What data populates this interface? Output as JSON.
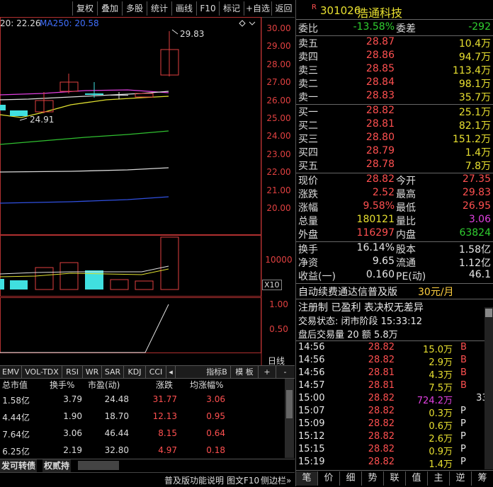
{
  "toolbar": {
    "items": [
      "复权",
      "叠加",
      "多股",
      "统计",
      "画线",
      "F10",
      "标记",
      "+自选",
      "返回"
    ]
  },
  "chart": {
    "ma_text": "20: 22.26",
    "ma250_text": "MA250: 20.58",
    "high_label": "29.83",
    "low_label": "24.91",
    "price_axis": [
      "30.00",
      "29.00",
      "28.00",
      "27.00",
      "26.00",
      "25.00",
      "24.00",
      "23.00",
      "22.00",
      "21.00",
      "20.00"
    ],
    "vol_axis": "10000",
    "vol_unit": "X10",
    "ind_axis": [
      "1.00",
      "0.50"
    ],
    "period": "日线"
  },
  "indicator_tabs": [
    "EMV",
    "VOL-TDX",
    "RSI",
    "WR",
    "SAR",
    "KDJ",
    "CCI"
  ],
  "indicator_right": [
    "指标B",
    "模 板",
    "+",
    "-"
  ],
  "stats": {
    "headers": [
      "总市值",
      "换手%",
      "市盈(动)",
      "涨跌",
      "均涨幅%"
    ],
    "rows": [
      [
        "1.58亿",
        "3.79",
        "24.48",
        "31.77",
        "3.06"
      ],
      [
        "4.44亿",
        "1.90",
        "18.70",
        "12.13",
        "0.95"
      ],
      [
        "7.64亿",
        "3.06",
        "46.44",
        "8.15",
        "0.64"
      ],
      [
        "6.25亿",
        "2.19",
        "32.80",
        "4.97",
        "0.18"
      ]
    ]
  },
  "bottom_tabs": [
    "发可转债",
    "权贰持"
  ],
  "status_bar": [
    "普及版功能说明",
    "图文F10",
    "侧边栏»"
  ],
  "quote": {
    "tag": "R",
    "code": "301026",
    "name": "浩通科技",
    "weibi_label": "委比",
    "weibi": "-13.58%",
    "weicha_label": "委差",
    "weicha": "-292",
    "sell": [
      {
        "label": "卖五",
        "price": "28.87",
        "vol": "10.4万"
      },
      {
        "label": "卖四",
        "price": "28.86",
        "vol": "94.7万"
      },
      {
        "label": "卖三",
        "price": "28.85",
        "vol": "113.4万"
      },
      {
        "label": "卖二",
        "price": "28.84",
        "vol": "98.1万"
      },
      {
        "label": "卖一",
        "price": "28.83",
        "vol": "35.7万"
      }
    ],
    "buy": [
      {
        "label": "买一",
        "price": "28.82",
        "vol": "25.1万"
      },
      {
        "label": "买二",
        "price": "28.81",
        "vol": "82.1万"
      },
      {
        "label": "买三",
        "price": "28.80",
        "vol": "151.2万"
      },
      {
        "label": "买四",
        "price": "28.79",
        "vol": "1.4万"
      },
      {
        "label": "买五",
        "price": "28.78",
        "vol": "7.8万"
      }
    ],
    "detail": [
      {
        "l1": "现价",
        "v1": "28.82",
        "l2": "今开",
        "v2": "27.35"
      },
      {
        "l1": "涨跌",
        "v1": "2.52",
        "l2": "最高",
        "v2": "29.83"
      },
      {
        "l1": "涨幅",
        "v1": "9.58%",
        "l2": "最低",
        "v2": "26.95"
      },
      {
        "l1": "总量",
        "v1": "180121",
        "l2": "量比",
        "v2": "3.06"
      },
      {
        "l1": "外盘",
        "v1": "116297",
        "l2": "内盘",
        "v2": "63824"
      }
    ],
    "fund": [
      {
        "l1": "换手",
        "v1": "16.14%",
        "l2": "股本",
        "v2": "1.58亿"
      },
      {
        "l1": "净资",
        "v1": "9.65",
        "l2": "流通",
        "v2": "1.12亿"
      },
      {
        "l1": "收益(一)",
        "v1": "0.160",
        "l2": "PE(动)",
        "v2": "46.1"
      }
    ],
    "promo1": "自动续费通达信普及版",
    "promo1_price": "30元/月",
    "promo2": "注册制 已盈利 表决权无差异",
    "trade_status": "交易状态: 闭市阶段 15:33:12",
    "after_hours": "盘后交易量 20 额 5.8万"
  },
  "ticks": [
    {
      "t": "14:56",
      "p": "28.82",
      "v": "15.0万",
      "d": "B",
      "n": "6"
    },
    {
      "t": "14:56",
      "p": "28.82",
      "v": "2.9万",
      "d": "B",
      "n": "2"
    },
    {
      "t": "14:56",
      "p": "28.81",
      "v": "4.3万",
      "d": "B",
      "n": "2"
    },
    {
      "t": "14:57",
      "p": "28.81",
      "v": "7.5万",
      "d": "B",
      "n": "5"
    },
    {
      "t": "15:00",
      "p": "28.82",
      "v": "724.2万",
      "d": "",
      "n": "331"
    },
    {
      "t": "15:07",
      "p": "28.82",
      "v": "0.3万",
      "d": "P",
      "n": "1"
    },
    {
      "t": "15:09",
      "p": "28.82",
      "v": "0.6万",
      "d": "P",
      "n": "1"
    },
    {
      "t": "15:12",
      "p": "28.82",
      "v": "2.6万",
      "d": "P",
      "n": "1"
    },
    {
      "t": "15:15",
      "p": "28.82",
      "v": "0.9万",
      "d": "P",
      "n": "1"
    },
    {
      "t": "15:19",
      "p": "28.82",
      "v": "1.4万",
      "d": "P",
      "n": "1"
    }
  ],
  "right_tabs": [
    "笔",
    "价",
    "细",
    "势",
    "联",
    "值",
    "主",
    "逆",
    "筹"
  ]
}
